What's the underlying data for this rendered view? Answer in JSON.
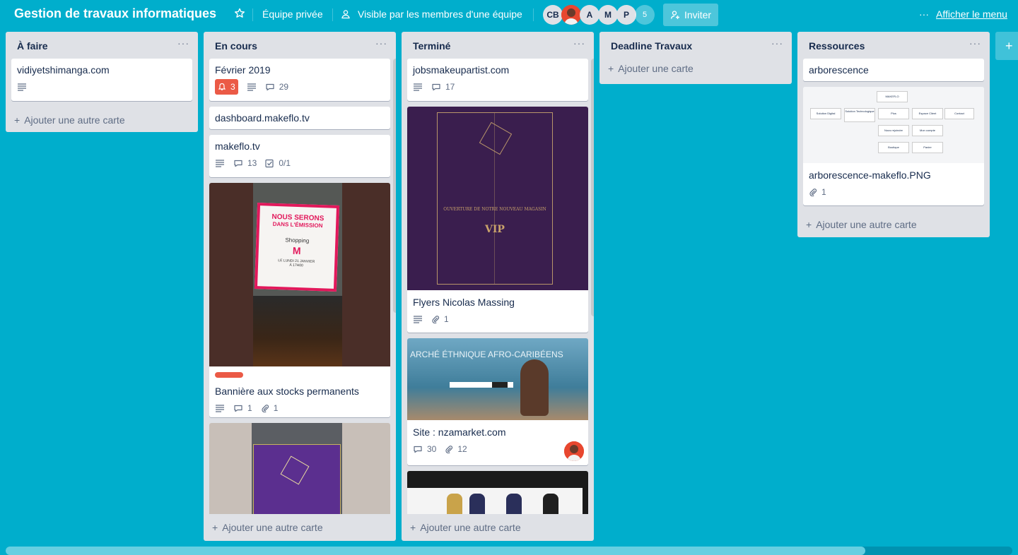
{
  "header": {
    "title": "Gestion de travaux informatiques",
    "team_label": "Équipe privée",
    "visibility_label": "Visible par les membres d'une équipe",
    "members": [
      "CB",
      "A",
      "M",
      "P"
    ],
    "members_extra_count": "5",
    "invite_label": "Inviter",
    "menu_label": "Afficher le menu",
    "menu_dots": "···"
  },
  "lists": [
    {
      "title": "À faire",
      "menu": "···",
      "cards": [
        {
          "title": "vidiyetshimanga.com"
        }
      ],
      "add_card": "Ajouter une autre carte"
    },
    {
      "title": "En cours",
      "menu": "···",
      "cards": [
        {
          "title": "Février 2019",
          "due_count": "3",
          "comments": "29"
        },
        {
          "title": "dashboard.makeflo.tv"
        },
        {
          "title": "makeflo.tv",
          "comments": "13",
          "checklist": "0/1"
        },
        {
          "title": "Bannière aux stocks permanents",
          "comments": "1",
          "attachments": "1",
          "cover_text_1": "NOUS SERONS",
          "cover_text_2": "DANS L'ÉMISSION",
          "cover_text_3": "Shopping",
          "cover_text_4": "LE LUNDI 21 JANVIER",
          "cover_text_5": "À 17H00"
        },
        {
          "title": ""
        }
      ],
      "add_card": "Ajouter une autre carte"
    },
    {
      "title": "Terminé",
      "menu": "···",
      "cards": [
        {
          "title": "jobsmakeupartist.com",
          "comments": "17"
        },
        {
          "title": "Flyers Nicolas Massing",
          "attachments": "1",
          "cover_text_1": "OUVERTURE DE NOTRE NOUVEAU MAGASIN",
          "cover_text_2": "VIP"
        },
        {
          "title": "Site : nzamarket.com",
          "comments": "30",
          "attachments": "12",
          "cover_text_1": "ARCHÉ ÉTHNIQUE AFRO-CARIBÉENS"
        },
        {
          "title": ""
        }
      ],
      "add_card": "Ajouter une autre carte"
    },
    {
      "title": "Deadline Travaux",
      "menu": "···",
      "cards": [],
      "add_card": "Ajouter une carte"
    },
    {
      "title": "Ressources",
      "menu": "···",
      "cards": [
        {
          "title": "arborescence"
        },
        {
          "title": "arborescence-makeflo.PNG",
          "attachments": "1",
          "diagram": [
            "MAKEFLO",
            "Solution Digital",
            "Solution Technologique",
            "Plus",
            "Espace Client",
            "Contact",
            "Nous rejoindre",
            "Mon compte",
            "Boutique",
            "Panier"
          ]
        }
      ],
      "add_card": "Ajouter une autre carte"
    }
  ],
  "colors": {
    "board_bg": "#00AECC",
    "list_bg": "#DFE1E6",
    "due_red": "#EB5A46",
    "label_red": "#EB5A46"
  }
}
